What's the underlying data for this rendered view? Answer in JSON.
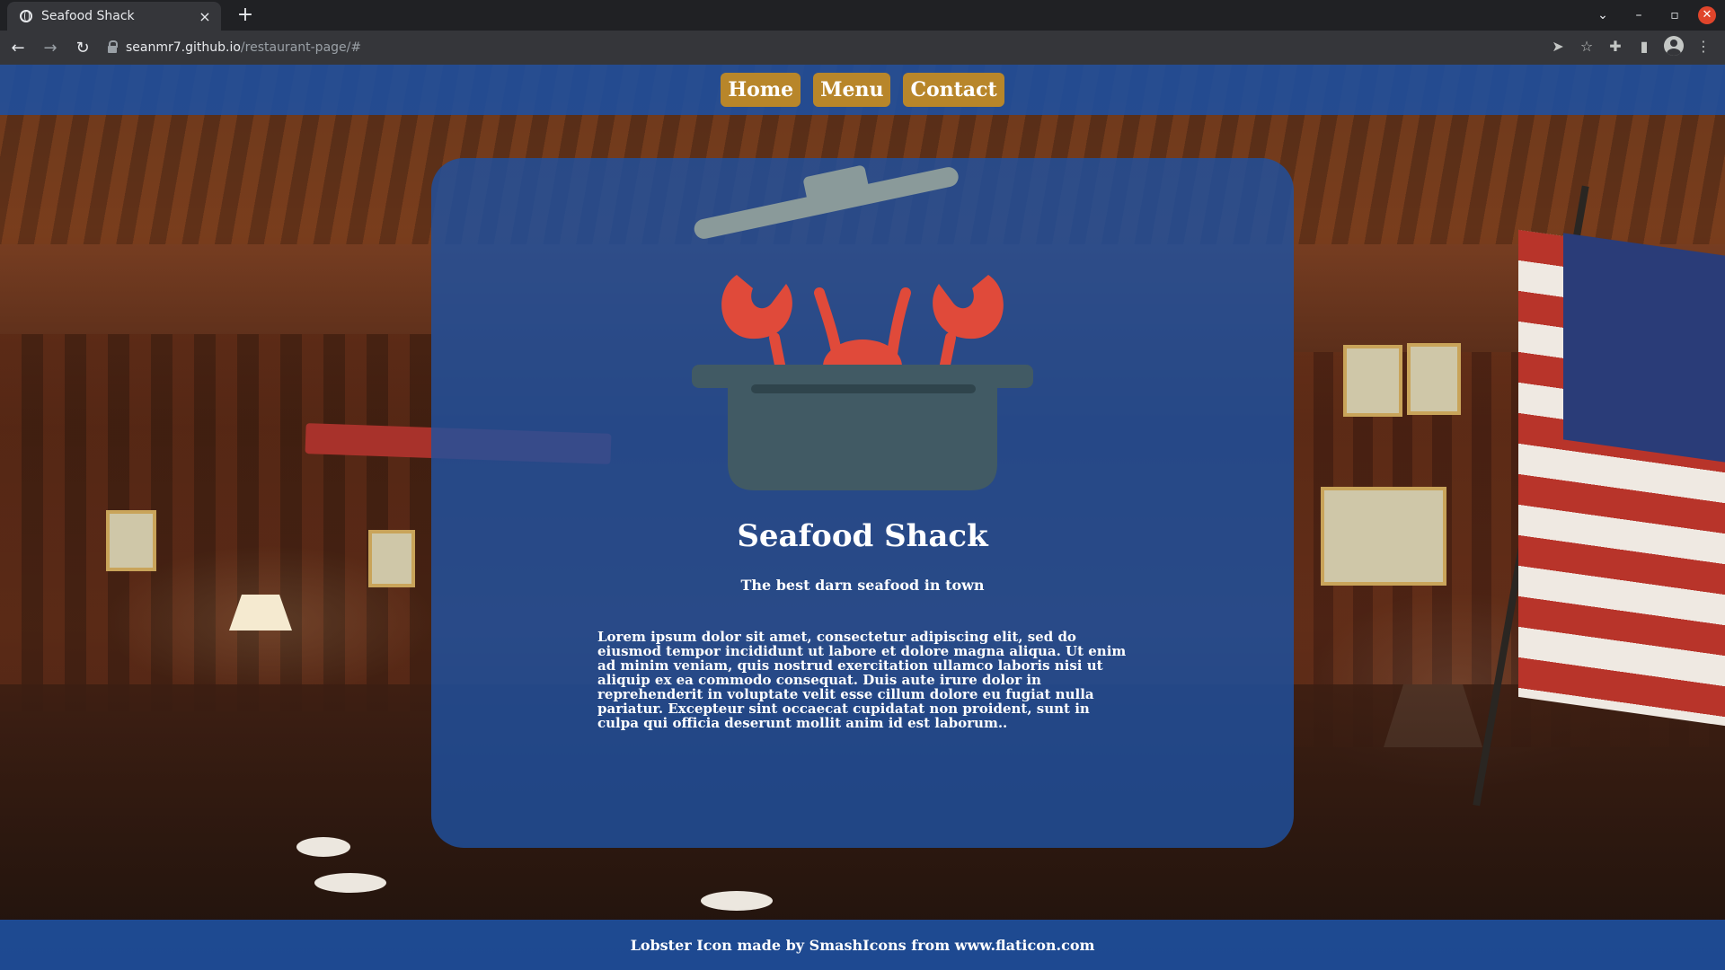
{
  "browser": {
    "tab_title": "Seafood Shack",
    "tab_close": "×",
    "new_tab": "+",
    "url_host": "seanmr7.github.io",
    "url_path": "/restaurant-page/#",
    "win_controls": {
      "dropdown": "⌄",
      "minimize": "–",
      "restore": "▫",
      "close": "✕"
    },
    "nav": {
      "back": "←",
      "forward": "→",
      "reload": "↻"
    },
    "toolbar_icons": {
      "send": "➤",
      "bookmark": "☆",
      "extensions": "✚",
      "sidepanel": "▮",
      "menu": "⋮"
    }
  },
  "nav": {
    "items": [
      {
        "label": "Home"
      },
      {
        "label": "Menu"
      },
      {
        "label": "Contact"
      }
    ]
  },
  "hero": {
    "title": "Seafood Shack",
    "tagline": "The best darn seafood in town",
    "body": "Lorem ipsum dolor sit amet, consectetur adipiscing elit, sed do eiusmod tempor incididunt ut labore et dolore magna aliqua. Ut enim ad minim veniam, quis nostrud exercitation ullamco laboris nisi ut aliquip ex ea commodo consequat. Duis aute irure dolor in reprehenderit in voluptate velit esse cillum dolore eu fugiat nulla pariatur. Excepteur sint occaecat cupidatat non proident, sunt in culpa qui officia deserunt mollit anim id est laborum..",
    "logo_icon": "lobster-pot-icon"
  },
  "footer": {
    "credit": "Lobster Icon made by SmashIcons from www.flaticon.com"
  },
  "colors": {
    "nav_bg": "#1e50a0",
    "nav_button": "#b8862a",
    "card_bg": "#1e50a0",
    "lobster": "#e04a3a",
    "pot": "#415a64",
    "lid": "#8a9a9a"
  }
}
